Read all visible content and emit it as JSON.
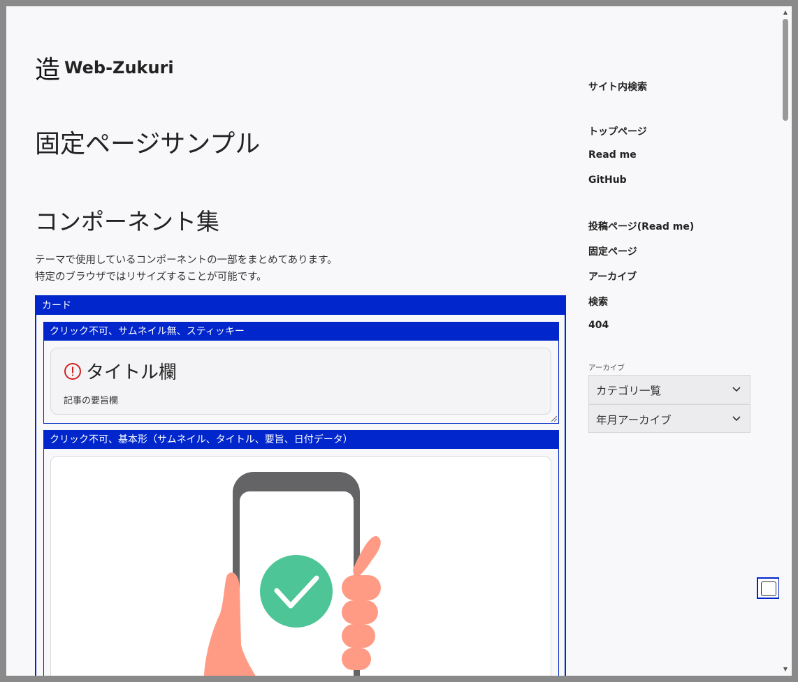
{
  "site": {
    "logo_mark": "造",
    "logo_text": "Web-Zukuri"
  },
  "page": {
    "title": "固定ページサンプル",
    "section_title": "コンポーネント集",
    "description": [
      "テーマで使用しているコンポーネントの一部をまとめてあります。",
      "特定のブラウザではリサイズすることが可能です。"
    ]
  },
  "card_section": {
    "header": "カード",
    "subsections": [
      {
        "header": "クリック不可、サムネイル無、スティッキー",
        "card_title": "タイトル欄",
        "card_summary": "記事の要旨欄"
      },
      {
        "header": "クリック不可、基本形（サムネイル、タイトル、要旨、日付データ）"
      }
    ]
  },
  "sidebar": {
    "search_label": "サイト内検索",
    "links_group1": [
      "トップページ",
      "Read me",
      "GitHub"
    ],
    "links_group2": [
      "投稿ページ(Read me)",
      "固定ページ",
      "アーカイブ",
      "検索",
      "404"
    ],
    "archive_label": "アーカイブ",
    "selects": [
      "カテゴリ一覧",
      "年月アーカイブ"
    ]
  },
  "colors": {
    "accent": "#0026cc",
    "alert": "#d32020",
    "check_green": "#4dc596",
    "hand": "#ff9b84",
    "phone": "#646466"
  },
  "icons": [
    "alert-circle-icon",
    "chevron-down-icon",
    "phone-check-illustration"
  ]
}
